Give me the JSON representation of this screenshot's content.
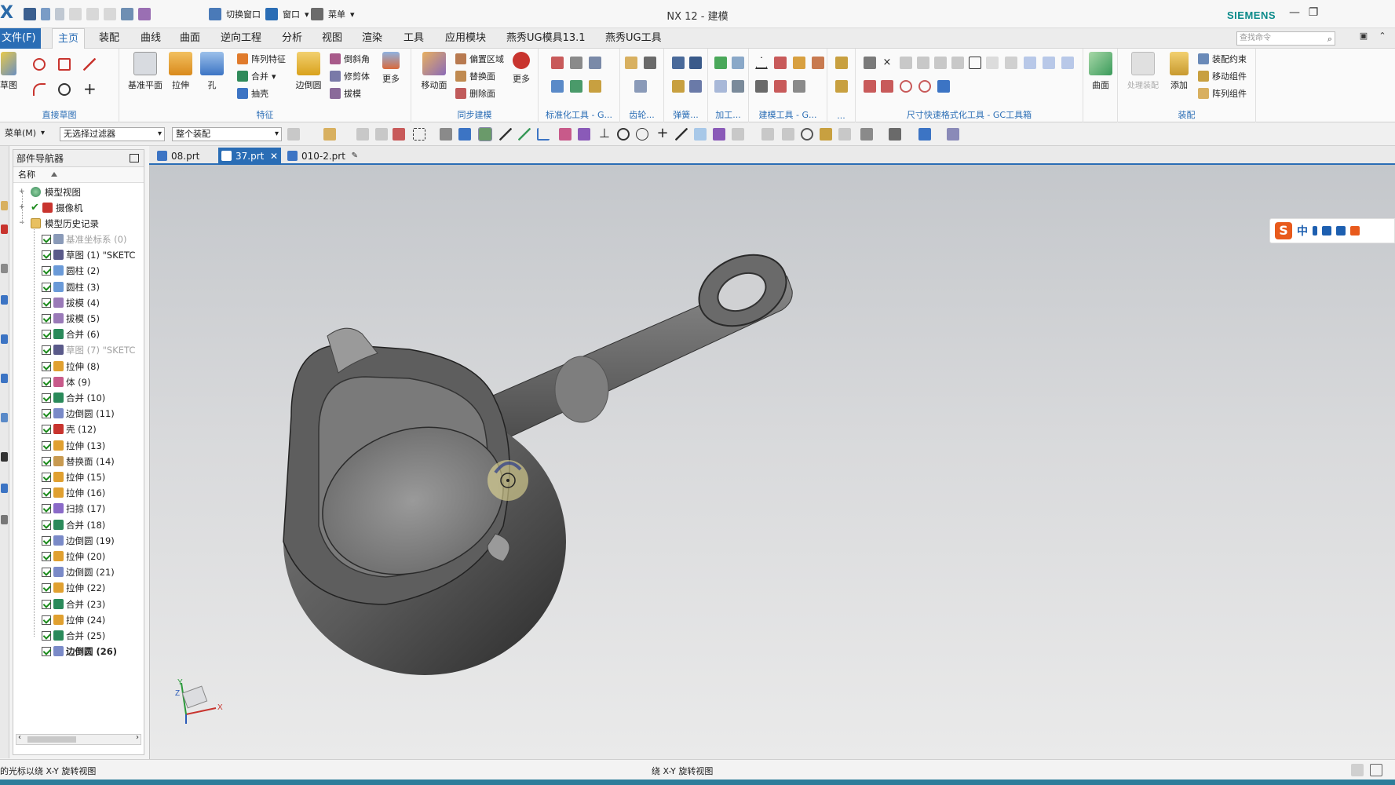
{
  "title_bar": {
    "logo": "X",
    "quick_access": {
      "switch_window": "切换窗口",
      "window": "窗口",
      "menu": "菜单"
    },
    "app_title": "NX 12 - 建模",
    "brand": "SIEMENS",
    "window_controls": {
      "minimize": "—",
      "restore": "❐"
    }
  },
  "menu_tabs": {
    "file": "文件(F)",
    "items": [
      "主页",
      "装配",
      "曲线",
      "曲面",
      "逆向工程",
      "分析",
      "视图",
      "渲染",
      "工具",
      "应用模块",
      "燕秀UG模具13.1",
      "燕秀UG工具"
    ],
    "active": "主页",
    "search_placeholder": "查找命令"
  },
  "ribbon": {
    "sketch_group": {
      "sketch_label": "草图",
      "group_label": "直接草图"
    },
    "feature_group": {
      "datum_plane": "基准平面",
      "extrude": "拉伸",
      "hole": "孔",
      "pattern": "阵列特征",
      "unite": "合并",
      "shell": "抽壳",
      "edge_blend": "边倒圆",
      "chamfer": "倒斜角",
      "trim_body": "修剪体",
      "draft": "拔模",
      "more": "更多",
      "group_label": "特征"
    },
    "sync_group": {
      "move_face": "移动面",
      "offset_region": "偏置区域",
      "replace_face": "替换面",
      "delete_face": "删除面",
      "more": "更多",
      "group_label": "同步建模"
    },
    "small_group_labels": [
      "标准化工具 - G...",
      "齿轮...",
      "弹簧...",
      "加工...",
      "建模工具 - G...",
      "..."
    ],
    "dim_group_label": "尺寸快速格式化工具 - GC工具箱",
    "surface": {
      "label": "曲面"
    },
    "assembly_group": {
      "process_assembly": "处理装配",
      "add": "添加",
      "constraint": "装配约束",
      "move_component": "移动组件",
      "pattern_component": "阵列组件",
      "group_label": "装配"
    }
  },
  "selection_bar": {
    "menu": "菜单(M)",
    "filter": "无选择过滤器",
    "scope": "整个装配"
  },
  "navigator": {
    "title": "部件导航器",
    "column_name": "名称",
    "roots": [
      {
        "label": "模型视图"
      },
      {
        "label": "摄像机"
      },
      {
        "label": "模型历史记录"
      }
    ],
    "features": [
      {
        "label": "基准坐标系 (0)",
        "dim": true
      },
      {
        "label": "草图 (1) \"SKETC",
        "dim": false
      },
      {
        "label": "圆柱 (2)",
        "dim": false
      },
      {
        "label": "圆柱 (3)",
        "dim": false
      },
      {
        "label": "拔模 (4)",
        "dim": false
      },
      {
        "label": "拔模 (5)",
        "dim": false
      },
      {
        "label": "合并 (6)",
        "dim": false
      },
      {
        "label": "草图 (7) \"SKETC",
        "dim": true
      },
      {
        "label": "拉伸 (8)",
        "dim": false
      },
      {
        "label": "体 (9)",
        "dim": false
      },
      {
        "label": "合并 (10)",
        "dim": false
      },
      {
        "label": "边倒圆 (11)",
        "dim": false
      },
      {
        "label": "壳 (12)",
        "dim": false
      },
      {
        "label": "拉伸 (13)",
        "dim": false
      },
      {
        "label": "替换面 (14)",
        "dim": false
      },
      {
        "label": "拉伸 (15)",
        "dim": false
      },
      {
        "label": "拉伸 (16)",
        "dim": false
      },
      {
        "label": "扫掠 (17)",
        "dim": false
      },
      {
        "label": "合并 (18)",
        "dim": false
      },
      {
        "label": "边倒圆 (19)",
        "dim": false
      },
      {
        "label": "拉伸 (20)",
        "dim": false
      },
      {
        "label": "边倒圆 (21)",
        "dim": false
      },
      {
        "label": "拉伸 (22)",
        "dim": false
      },
      {
        "label": "合并 (23)",
        "dim": false
      },
      {
        "label": "拉伸 (24)",
        "dim": false
      },
      {
        "label": "合并 (25)",
        "dim": false
      },
      {
        "label": "边倒圆 (26)",
        "dim": false,
        "bold": true
      }
    ]
  },
  "doc_tabs": [
    {
      "label": "08.prt",
      "active": false
    },
    {
      "label": "37.prt",
      "active": true
    },
    {
      "label": "010-2.prt",
      "active": false
    }
  ],
  "triad": {
    "x": "X",
    "y": "Y",
    "z": "Z"
  },
  "ime": {
    "logo": "S",
    "lang": "中"
  },
  "status": {
    "left": "的光标以绕 X-Y 旋转视图",
    "center": "绕 X-Y 旋转视图"
  },
  "colors": {
    "accent": "#2a6db5",
    "brand": "#0a8a8a",
    "status_strip": "#2d7d9a",
    "check": "#1a8a1a"
  }
}
